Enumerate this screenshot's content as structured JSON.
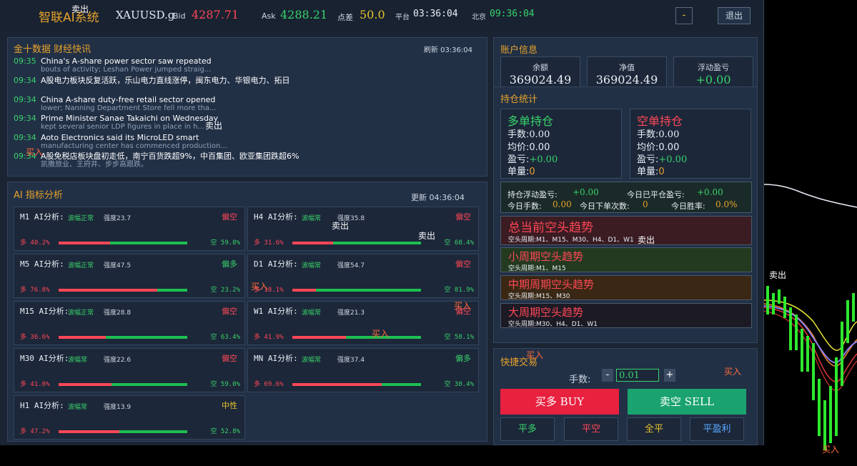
{
  "header": {
    "app_title": "智联AI系统",
    "symbol": "XAUUSD.g",
    "bid_label": "Bid",
    "bid_value": "4287.71",
    "ask_label": "Ask",
    "ask_value": "4288.21",
    "spread_label": "点差",
    "spread_value": "50.0",
    "platform_label": "平台",
    "platform_time": "03:36:04",
    "beijing_label": "北京",
    "beijing_time": "09:36:04",
    "minimize_label": "-",
    "exit_label": "退出"
  },
  "news": {
    "title": "金十数据 财经快讯",
    "refresh": "刷新 03:36:04",
    "items": [
      {
        "time": "09:35",
        "headline": "China's A-share power sector saw repeated",
        "sub": "bouts of activity; Leshan Power jumped straig..."
      },
      {
        "time": "09:34",
        "headline": "A股电力板块反复活跃，乐山电力直线涨停，闽东电力、华银电力、拓日",
        "sub": ""
      },
      {
        "time": "09:34",
        "headline": "China A-share duty-free retail sector opened",
        "sub": "lower; Nanning Department Store fell more tha..."
      },
      {
        "time": "09:34",
        "headline": "Prime Minister Sanae Takaichi on Wednesday",
        "sub": "kept several senior LDP figures in place in h..."
      },
      {
        "time": "09:34",
        "headline": "Aoto Electronics said its MicroLED smart",
        "sub": "manufacturing center has commenced production..."
      },
      {
        "time": "09:34",
        "headline": "A股免税店板块盘初走低，南宁百货跌超9%，中百集团、欧亚集团跌超6%",
        "sub": "凯撒旅业、王府井、步步高跟跌。"
      }
    ]
  },
  "ai": {
    "title": "AI 指标分析",
    "update": "更新 04:36:04",
    "boxes": [
      {
        "label": "M1 AI分析:",
        "state": "波幅正常",
        "strength": "强度23.7",
        "bias": "偏空",
        "bias_color": "#ff4757",
        "long": "多 40.2%",
        "short": "空 59.8%",
        "long_frac": 0.402
      },
      {
        "label": "H4 AI分析:",
        "state": "波幅常",
        "strength": "强度35.8",
        "bias": "偏空",
        "bias_color": "#ff4757",
        "long": "多 31.6%",
        "short": "空 68.4%",
        "long_frac": 0.316
      },
      {
        "label": "M5 AI分析:",
        "state": "波幅正常",
        "strength": "强度47.5",
        "bias": "偏多",
        "bias_color": "#39d36b",
        "long": "多 76.8%",
        "short": "空 23.2%",
        "long_frac": 0.768
      },
      {
        "label": "D1 AI分析:",
        "state": "波幅常",
        "strength": "强度54.7",
        "bias": "偏空",
        "bias_color": "#ff4757",
        "long": "多 18.1%",
        "short": "空 81.9%",
        "long_frac": 0.181
      },
      {
        "label": "M15 AI分析:",
        "state": "波幅正常",
        "strength": "强度28.8",
        "bias": "偏空",
        "bias_color": "#ff4757",
        "long": "多 36.6%",
        "short": "空 63.4%",
        "long_frac": 0.366
      },
      {
        "label": "W1 AI分析:",
        "state": "波幅常",
        "strength": "强度21.3",
        "bias": "偏空",
        "bias_color": "#ff4757",
        "long": "多 41.9%",
        "short": "空 58.1%",
        "long_frac": 0.419
      },
      {
        "label": "M30 AI分析:",
        "state": "波幅常",
        "strength": "强度22.6",
        "bias": "偏空",
        "bias_color": "#ff4757",
        "long": "多 41.0%",
        "short": "空 59.0%",
        "long_frac": 0.41
      },
      {
        "label": "MN AI分析:",
        "state": "波幅常",
        "strength": "强度37.4",
        "bias": "偏多",
        "bias_color": "#39d36b",
        "long": "多 69.6%",
        "short": "空 30.4%",
        "long_frac": 0.696
      },
      {
        "label": "H1 AI分析:",
        "state": "波幅常",
        "strength": "强度13.9",
        "bias": "中性",
        "bias_color": "#e6c32b",
        "long": "多 47.2%",
        "short": "空 52.8%",
        "long_frac": 0.472
      }
    ]
  },
  "account": {
    "title": "账户信息",
    "balance_label": "余额",
    "balance_value": "369024.49",
    "equity_label": "净值",
    "equity_value": "369024.49",
    "float_label": "浮动盈亏",
    "float_value": "+0.00"
  },
  "positions": {
    "title": "持仓统计",
    "long": {
      "title": "多单持仓",
      "lots_label": "手数:",
      "lots": "0.00",
      "avg_label": "均价:",
      "avg": "0.00",
      "pnl_label": "盈亏:",
      "pnl": "+0.00",
      "count_label": "单量:",
      "count": "0"
    },
    "short": {
      "title": "空单持仓",
      "lots_label": "手数:",
      "lots": "0.00",
      "avg_label": "均价:",
      "avg": "0.00",
      "pnl_label": "盈亏:",
      "pnl": "+0.00",
      "count_label": "单量:",
      "count": "0"
    },
    "float_pnl_label": "持仓浮动盈亏:",
    "float_pnl": "+0.00",
    "closed_pnl_label": "今日已平仓盈亏:",
    "closed_pnl": "+0.00",
    "today_lots_label": "今日手数:",
    "today_lots": "0.00",
    "today_orders_label": "今日下单次数:",
    "today_orders": "0",
    "winrate_label": "今日胜率:",
    "winrate": "0.0%"
  },
  "trends": [
    {
      "title": "总当前空头趋势",
      "sub": "空头周期:M1、M15、M30、H4、D1、W1"
    },
    {
      "title": "小周期空头趋势",
      "sub": "空头周期:M1、M15"
    },
    {
      "title": "中期周期空头趋势",
      "sub": "空头周期:M15、M30"
    },
    {
      "title": "大周期空头趋势",
      "sub": "空头周期:M30、H4、D1、W1"
    }
  ],
  "quick_trade": {
    "title": "快捷交易",
    "lots_label": "手数:",
    "minus_label": "-",
    "lots_value": "0.01",
    "plus_label": "+",
    "buy_label": "买多 BUY",
    "sell_label": "卖空 SELL",
    "close_long": "平多",
    "close_short": "平空",
    "close_all": "全平",
    "close_profit": "平盈利"
  },
  "overlays": {
    "sell": "卖出",
    "buy": "买入"
  },
  "colors": {
    "panel_bg": "#223046",
    "accent_gold": "#e6a22b",
    "up_green": "#39d36b",
    "down_red": "#ff4757",
    "buy_button": "#e8213f",
    "sell_button": "#1aa36e"
  }
}
